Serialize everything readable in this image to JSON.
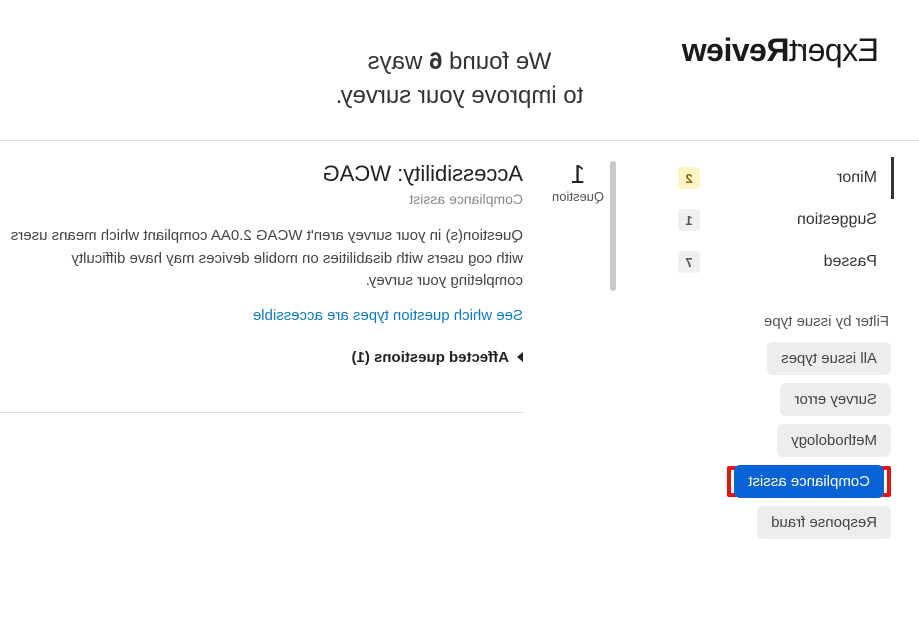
{
  "brand": {
    "part1": "Expert",
    "part2": "Review"
  },
  "headline": {
    "prefix": "We found ",
    "count": "6",
    "suffix": " ways",
    "line2": "to improve your survey."
  },
  "sidebar": {
    "severities": [
      {
        "label": "Minor",
        "count": "2",
        "warn": true,
        "active": true
      },
      {
        "label": "Suggestion",
        "count": "1",
        "warn": false,
        "active": false
      },
      {
        "label": "Passed",
        "count": "7",
        "warn": false,
        "active": false
      }
    ],
    "filter_label": "Filter by issue type",
    "filters": [
      {
        "label": "All issue types",
        "selected": false,
        "highlighted": false
      },
      {
        "label": "Survey error",
        "selected": false,
        "highlighted": false
      },
      {
        "label": "Methodology",
        "selected": false,
        "highlighted": false
      },
      {
        "label": "Compliance assist",
        "selected": true,
        "highlighted": true
      },
      {
        "label": "Response fraud",
        "selected": false,
        "highlighted": false
      }
    ]
  },
  "issue": {
    "count_num": "1",
    "count_label": "Question",
    "title": "Accessibility: WCAG",
    "subtitle": "Compliance assist",
    "description": "Question(s) in your survey aren't WCAG 2.0AA compliant which means users with cog users with disabilities on mobile devices may have difficulty completing your survey.",
    "link": "See which question types are accessible",
    "affected": "Affected questions (1)"
  }
}
